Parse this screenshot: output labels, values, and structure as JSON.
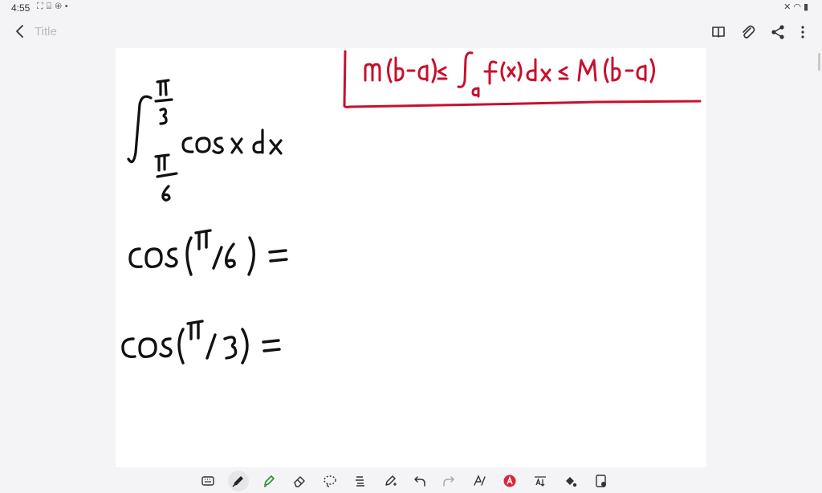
{
  "status_bar": {
    "time": "4:55",
    "left_icons": [
      "screenshot-icon",
      "scan-icon",
      "globe-icon",
      "dot-icon"
    ],
    "right_icons": [
      "mute-icon",
      "wifi-icon",
      "battery-icon"
    ]
  },
  "app_bar": {
    "title_placeholder": "Title",
    "actions": [
      "book-icon",
      "paperclip-icon",
      "share-icon",
      "more-icon"
    ]
  },
  "note": {
    "boxed_formula": "m(b-a) ≤ ∫_a f(x)dx ≤ M(b-a)",
    "integral": "∫ from π/6 to π/3 cos x dx",
    "line1": "cos(π/6) =",
    "line2": "cos(π/3) =",
    "ink_color": "#111111",
    "box_color": "#c8102e"
  },
  "toolbar": {
    "tools": [
      "keyboard-icon",
      "pen-icon",
      "highlighter-icon",
      "eraser-icon",
      "lasso-icon",
      "text-format-icon",
      "shape-pen-icon",
      "undo-icon",
      "redo-icon",
      "handwriting-icon",
      "text-color-icon",
      "text-style-icon",
      "fill-icon",
      "image-icon"
    ],
    "active_tool": "pen-icon"
  }
}
